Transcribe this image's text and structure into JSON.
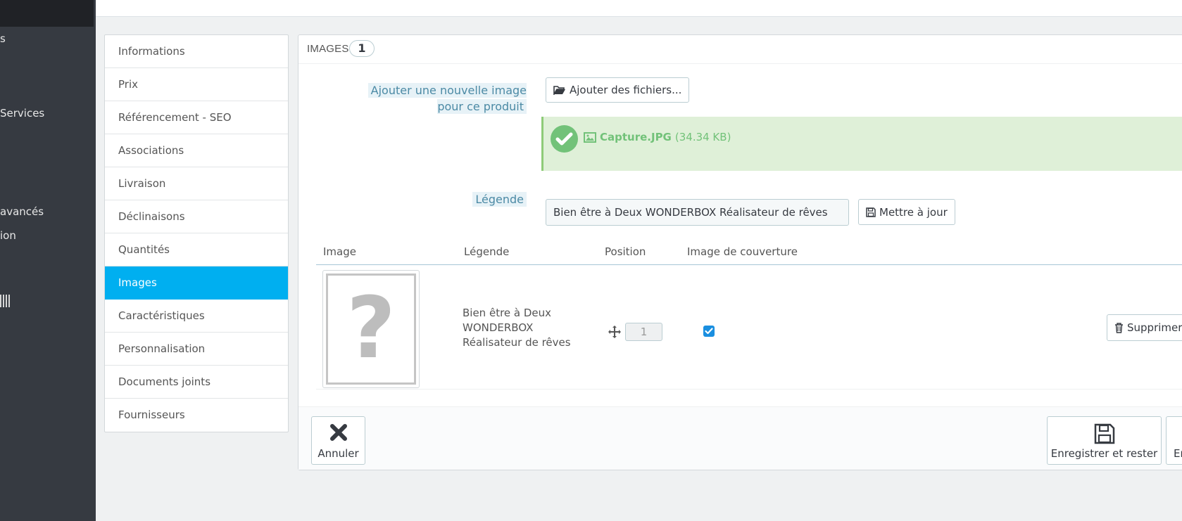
{
  "sidebar": {
    "items": [
      {
        "label": "s"
      },
      {
        "label": "Services"
      },
      {
        "label": "avancés"
      },
      {
        "label": "ion"
      }
    ]
  },
  "tabs": [
    {
      "label": "Informations"
    },
    {
      "label": "Prix"
    },
    {
      "label": "Référencement - SEO"
    },
    {
      "label": "Associations"
    },
    {
      "label": "Livraison"
    },
    {
      "label": "Déclinaisons"
    },
    {
      "label": "Quantités"
    },
    {
      "label": "Images",
      "active": true
    },
    {
      "label": "Caractéristiques"
    },
    {
      "label": "Personnalisation"
    },
    {
      "label": "Documents joints"
    },
    {
      "label": "Fournisseurs"
    }
  ],
  "panel": {
    "title": "IMAGES",
    "count": "1",
    "add_image_label": "Ajouter une nouvelle image pour ce produit",
    "add_files_button": "Ajouter des fichiers...",
    "upload": {
      "file_name": "Capture.JPG",
      "file_size": "(34.34 KB)"
    },
    "legend_label": "Légende",
    "legend_value": "Bien être à Deux WONDERBOX Réalisateur de rêves",
    "update_button": "Mettre à jour",
    "table": {
      "headers": [
        "Image",
        "Légende",
        "Position",
        "Image de couverture"
      ],
      "rows": [
        {
          "legend": "Bien être à Deux WONDERBOX Réalisateur de rêves",
          "position": "1",
          "cover": true,
          "delete_label": "Supprimer cett"
        }
      ]
    },
    "footer": {
      "cancel": "Annuler",
      "save_stay": "Enregistrer et rester",
      "save_partial": "En"
    }
  },
  "colors": {
    "accent": "#00aff0",
    "sidebar": "#363a41",
    "success_bg": "#dff0d8",
    "success": "#72c279",
    "label_blue": "#4c8aa5"
  },
  "icons": [
    "folder-open-icon",
    "check-circle-icon",
    "image-icon",
    "floppy-disk-icon",
    "move-arrows-icon",
    "trash-icon",
    "close-x-icon",
    "placeholder-question-icon"
  ]
}
